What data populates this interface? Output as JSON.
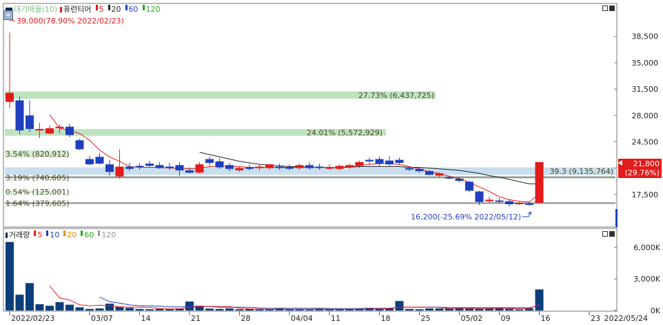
{
  "price_legend": {
    "title": "대기매물(10)",
    "ma_title": "퓨런티어",
    "ma": [
      {
        "label": "5",
        "color": "#e31b1b"
      },
      {
        "label": "20",
        "color": "#222222"
      },
      {
        "label": "60",
        "color": "#1f3fbf"
      },
      {
        "label": "120",
        "color": "#27a61f"
      }
    ]
  },
  "volume_legend": {
    "title": "거래량",
    "ma": [
      {
        "label": "5",
        "color": "#e31b1b"
      },
      {
        "label": "10",
        "color": "#1f3fbf"
      },
      {
        "label": "20",
        "color": "#e08a00"
      },
      {
        "label": "60",
        "color": "#27a61f"
      },
      {
        "label": "120",
        "color": "#999999"
      }
    ]
  },
  "annotations": {
    "high": "39,000(78.90% 2022/02/23)",
    "low": "16,200(-25.69% 2022/05/12)",
    "current_price": "21,800",
    "current_change": "(29.76%)"
  },
  "overhang_bands": [
    {
      "label": "27.73% (6,437,725)"
    },
    {
      "label": "24.01% (5,572,929)"
    },
    {
      "label": "3.54% (820,912)"
    },
    {
      "label": "39.3",
      "label2": "(9,135,764)"
    },
    {
      "label": "3.19% (740,605)"
    },
    {
      "label": "0.54% (125,001)"
    },
    {
      "label": "1.64% (379,605)"
    }
  ],
  "chart_data": [
    {
      "type": "candlestick",
      "title": "퓨런티어",
      "x_tick_labels": [
        "2022/02/23",
        "03/07",
        "14",
        "21",
        "28",
        "04/04",
        "11",
        "18",
        "25",
        "05/02",
        "09",
        "16",
        "23",
        "2022/05/24"
      ],
      "y_tick_labels": [
        "38,500",
        "35,000",
        "31,500",
        "28,000",
        "24,500",
        "21,000",
        "17,500"
      ],
      "ylim": [
        14000,
        41500
      ],
      "candles": [
        {
          "o": 29800,
          "h": 39000,
          "l": 29000,
          "c": 31000
        },
        {
          "o": 30000,
          "h": 30500,
          "l": 25500,
          "c": 26000
        },
        {
          "o": 28000,
          "h": 30000,
          "l": 25800,
          "c": 26200
        },
        {
          "o": 26000,
          "h": 27000,
          "l": 25000,
          "c": 26200
        },
        {
          "o": 25600,
          "h": 26700,
          "l": 25500,
          "c": 26300
        },
        {
          "o": 26300,
          "h": 26800,
          "l": 25700,
          "c": 26500
        },
        {
          "o": 26500,
          "h": 26900,
          "l": 25100,
          "c": 25400
        },
        {
          "o": 24700,
          "h": 24900,
          "l": 23400,
          "c": 23500
        },
        {
          "o": 22200,
          "h": 22600,
          "l": 21400,
          "c": 21500
        },
        {
          "o": 22500,
          "h": 23000,
          "l": 21500,
          "c": 21600
        },
        {
          "o": 21500,
          "h": 22100,
          "l": 20000,
          "c": 20500
        },
        {
          "o": 19900,
          "h": 23500,
          "l": 19600,
          "c": 21200
        },
        {
          "o": 21200,
          "h": 21700,
          "l": 20600,
          "c": 20900
        },
        {
          "o": 21300,
          "h": 21600,
          "l": 20800,
          "c": 21200
        },
        {
          "o": 21600,
          "h": 22000,
          "l": 21100,
          "c": 21300
        },
        {
          "o": 21400,
          "h": 21800,
          "l": 20900,
          "c": 21000
        },
        {
          "o": 21200,
          "h": 21700,
          "l": 20800,
          "c": 21100
        },
        {
          "o": 21400,
          "h": 21800,
          "l": 20000,
          "c": 20700
        },
        {
          "o": 20700,
          "h": 21100,
          "l": 20300,
          "c": 20400
        },
        {
          "o": 20400,
          "h": 21800,
          "l": 20300,
          "c": 21500
        },
        {
          "o": 22200,
          "h": 22500,
          "l": 21300,
          "c": 21700
        },
        {
          "o": 21900,
          "h": 22300,
          "l": 20900,
          "c": 21100
        },
        {
          "o": 21400,
          "h": 21700,
          "l": 20600,
          "c": 20900
        },
        {
          "o": 20700,
          "h": 21200,
          "l": 20500,
          "c": 21000
        },
        {
          "o": 21100,
          "h": 21500,
          "l": 20700,
          "c": 20900
        },
        {
          "o": 21000,
          "h": 21500,
          "l": 20700,
          "c": 21200
        },
        {
          "o": 21000,
          "h": 21500,
          "l": 20800,
          "c": 21500
        },
        {
          "o": 21200,
          "h": 21600,
          "l": 20800,
          "c": 21000
        },
        {
          "o": 21100,
          "h": 21500,
          "l": 20700,
          "c": 21000
        },
        {
          "o": 21000,
          "h": 21600,
          "l": 20800,
          "c": 21400
        },
        {
          "o": 21400,
          "h": 21800,
          "l": 20800,
          "c": 21000
        },
        {
          "o": 21200,
          "h": 21600,
          "l": 20800,
          "c": 21100
        },
        {
          "o": 21000,
          "h": 21500,
          "l": 20800,
          "c": 21100
        },
        {
          "o": 20900,
          "h": 21500,
          "l": 20700,
          "c": 21300
        },
        {
          "o": 21100,
          "h": 21600,
          "l": 20900,
          "c": 21400
        },
        {
          "o": 21300,
          "h": 22000,
          "l": 21000,
          "c": 21800
        },
        {
          "o": 22100,
          "h": 22400,
          "l": 21500,
          "c": 21900
        },
        {
          "o": 22200,
          "h": 22500,
          "l": 21300,
          "c": 21600
        },
        {
          "o": 22000,
          "h": 22600,
          "l": 21300,
          "c": 21500
        },
        {
          "o": 22100,
          "h": 22400,
          "l": 21500,
          "c": 21700
        },
        {
          "o": 21000,
          "h": 21200,
          "l": 20600,
          "c": 20800
        },
        {
          "o": 20900,
          "h": 21100,
          "l": 20400,
          "c": 20600
        },
        {
          "o": 20600,
          "h": 20800,
          "l": 20000,
          "c": 20100
        },
        {
          "o": 20000,
          "h": 20400,
          "l": 19800,
          "c": 20300
        },
        {
          "o": 19800,
          "h": 20000,
          "l": 19500,
          "c": 19700
        },
        {
          "o": 19600,
          "h": 19800,
          "l": 19100,
          "c": 19300
        },
        {
          "o": 19200,
          "h": 19300,
          "l": 17800,
          "c": 18000
        },
        {
          "o": 17900,
          "h": 18000,
          "l": 16100,
          "c": 16500
        },
        {
          "o": 16600,
          "h": 17200,
          "l": 16400,
          "c": 16800
        },
        {
          "o": 16700,
          "h": 17000,
          "l": 16300,
          "c": 16600
        },
        {
          "o": 16600,
          "h": 16900,
          "l": 15900,
          "c": 16200
        },
        {
          "o": 16200,
          "h": 16500,
          "l": 16100,
          "c": 16400
        },
        {
          "o": 16300,
          "h": 16500,
          "l": 16000,
          "c": 16200
        },
        {
          "o": 16400,
          "h": 21800,
          "l": 16300,
          "c": 21800
        }
      ],
      "ma5": [
        null,
        null,
        null,
        null,
        28100,
        26300,
        26000,
        25600,
        24700,
        23400,
        22500,
        21900,
        21200,
        21100,
        21100,
        21100,
        21000,
        21000,
        20900,
        21000,
        21200,
        21300,
        21200,
        21200,
        21100,
        21100,
        21100,
        21100,
        21100,
        21100,
        21100,
        21100,
        21100,
        21100,
        21200,
        21300,
        21500,
        21600,
        21600,
        21500,
        21200,
        20900,
        20500,
        20300,
        19900,
        19600,
        19100,
        18500,
        17900,
        17200,
        16800,
        16600,
        16500,
        17600
      ],
      "ma20": [
        null,
        null,
        null,
        null,
        null,
        null,
        null,
        null,
        null,
        null,
        null,
        null,
        null,
        null,
        null,
        null,
        null,
        null,
        null,
        23100,
        22800,
        22500,
        22200,
        21900,
        21700,
        21500,
        21400,
        21300,
        21200,
        21200,
        21100,
        21100,
        21100,
        21100,
        21100,
        21200,
        21200,
        21200,
        21200,
        21200,
        21100,
        21100,
        21000,
        20900,
        20800,
        20700,
        20500,
        20300,
        20000,
        19800,
        19500,
        19200,
        18900,
        18900
      ],
      "overhang_band_ranges": [
        [
          30200,
          31200
        ],
        [
          25300,
          26200
        ],
        [
          22400,
          23400
        ],
        [
          20100,
          21100
        ],
        [
          19600,
          19900
        ],
        [
          17700,
          18000
        ],
        [
          16200,
          16500
        ]
      ],
      "current_price": 21800,
      "high": 39000,
      "low": 16200
    },
    {
      "type": "bar",
      "title": "거래량",
      "y_tick_labels": [
        "6,000K",
        "3,000K",
        "0K"
      ],
      "ylim": [
        0,
        7200
      ],
      "values": [
        6500,
        1500,
        2600,
        600,
        450,
        800,
        550,
        300,
        150,
        200,
        650,
        350,
        250,
        150,
        120,
        150,
        120,
        200,
        850,
        450,
        180,
        150,
        200,
        120,
        150,
        100,
        100,
        200,
        120,
        100,
        80,
        150,
        100,
        100,
        120,
        150,
        250,
        150,
        180,
        900,
        150,
        120,
        200,
        200,
        200,
        200,
        180,
        150,
        200,
        300,
        150,
        100,
        200,
        2000
      ],
      "ma5": [
        null,
        null,
        null,
        null,
        2330,
        1190,
        1000,
        540,
        450,
        500,
        470,
        350,
        320,
        320,
        300,
        190,
        150,
        150,
        290,
        360,
        390,
        370,
        370,
        220,
        160,
        140,
        120,
        130,
        120,
        120,
        120,
        130,
        110,
        110,
        110,
        120,
        140,
        150,
        170,
        330,
        330,
        320,
        320,
        310,
        170,
        200,
        200,
        190,
        190,
        210,
        200,
        180,
        190,
        550
      ],
      "ma10": [
        null,
        null,
        null,
        null,
        null,
        null,
        null,
        null,
        null,
        1270,
        830,
        710,
        530,
        450,
        450,
        410,
        350,
        340,
        360,
        390,
        370,
        310,
        320,
        310,
        310,
        240,
        200,
        210,
        200,
        210,
        200,
        210,
        190,
        190,
        180,
        190,
        200,
        200,
        220,
        310,
        310,
        310,
        320,
        320,
        270,
        270,
        270,
        270,
        270,
        260,
        260,
        260,
        270,
        440
      ]
    }
  ]
}
